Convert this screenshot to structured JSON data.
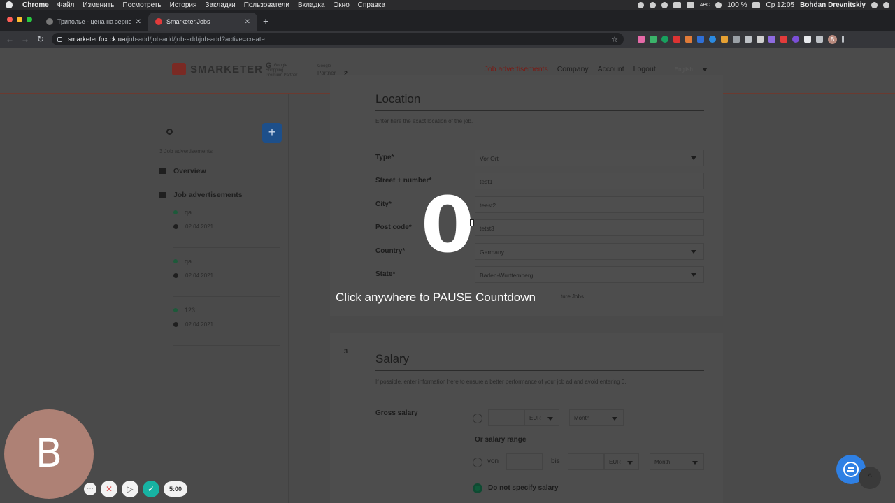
{
  "menubar": {
    "app": "Chrome",
    "items": [
      "Файл",
      "Изменить",
      "Посмотреть",
      "История",
      "Закладки",
      "Пользователи",
      "Вкладка",
      "Окно",
      "Справка"
    ],
    "battery": "100 %",
    "clock": "Ср 12:05",
    "user": "Bohdan Drevnitskiy",
    "abc": "ABC"
  },
  "tabs": [
    {
      "title": "Триполье - цена на зерно, ка",
      "close": "✕"
    },
    {
      "title": "Smarketer.Jobs",
      "close": "✕"
    }
  ],
  "newtab": "+",
  "address": {
    "host": "smarketer.fox.ck.ua",
    "path": "/job-add/job-add/job-add/job-add?active=create"
  },
  "header": {
    "logo": "SMARKETER",
    "google_badge_line1": "Google Shopping",
    "google_badge_line2": "Premium Partner",
    "partner_line1": "Google",
    "partner_line2": "Partner",
    "nav": [
      "Job advertisements",
      "Company",
      "Account",
      "Logout"
    ],
    "language": "English"
  },
  "sidebar": {
    "count_text": "3 Job advertisements",
    "overview": "Overview",
    "job_ads": "Job advertisements",
    "jobs": [
      {
        "title": "qa",
        "date": "02.04.2021"
      },
      {
        "title": "qa",
        "date": "02.04.2021"
      },
      {
        "title": "123",
        "date": "02.04.2021"
      }
    ]
  },
  "location": {
    "number": "2",
    "title": "Location",
    "hint": "Enter here the exact location of the job.",
    "fields": [
      {
        "label": "Type*",
        "value": "Vor Ort"
      },
      {
        "label": "Street + number*",
        "value": "test1"
      },
      {
        "label": "City*",
        "value": "teest2"
      },
      {
        "label": "Post code*",
        "value": "tetst3"
      },
      {
        "label": "Country*",
        "value": "Germany"
      },
      {
        "label": "State*",
        "value": "Baden-Wurttemberg"
      }
    ],
    "feature_note": "ture Jobs"
  },
  "salary": {
    "number": "3",
    "title": "Salary",
    "hint": "If possible, enter information here to ensure a better performance of your job ad and avoid entering 0.",
    "gross_label": "Gross salary",
    "currency": "EUR",
    "period": "Month",
    "range_label": "Or salary range",
    "from": "von",
    "to": "bis",
    "no_salary": "Do not specify salary"
  },
  "overlay": {
    "countdown": "0",
    "message": "Click anywhere to PAUSE Countdown"
  },
  "recorder": {
    "avatar_letter": "B",
    "timer": "5:00"
  },
  "colors": {
    "accent_red": "#7a1a14",
    "chat_blue": "#2f80e4",
    "record_teal": "#17b3a3"
  }
}
